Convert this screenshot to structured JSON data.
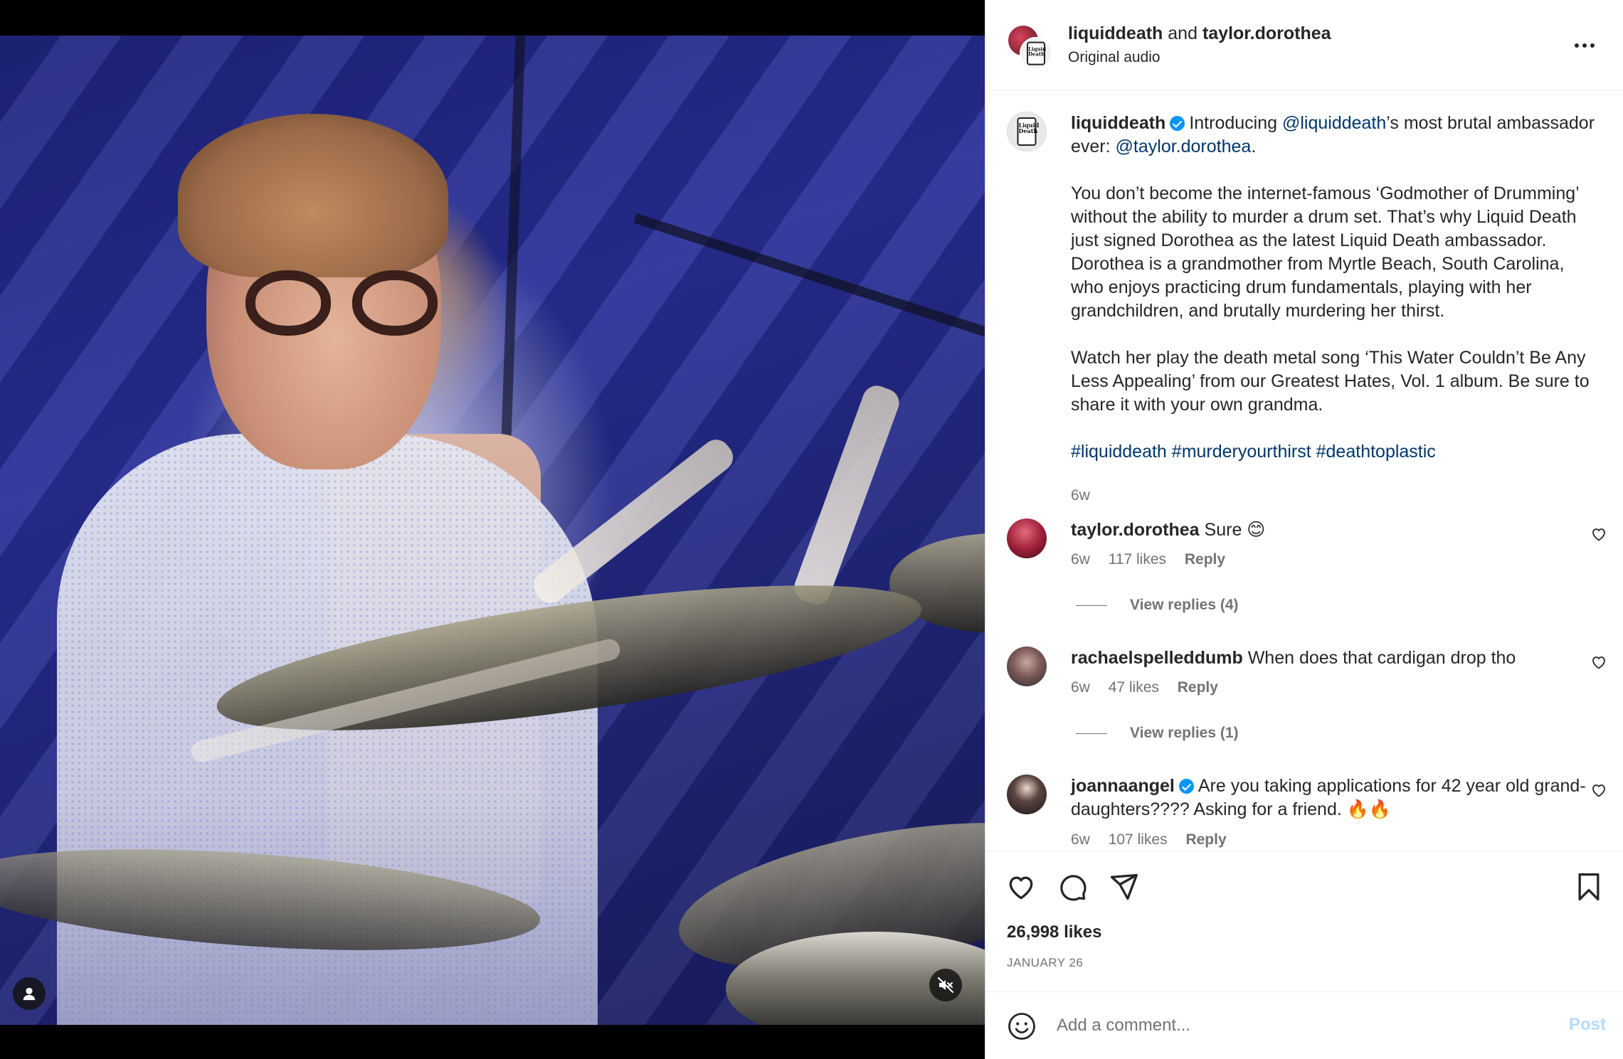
{
  "post": {
    "collaborators": [
      "liquiddeath",
      "taylor.dorothea"
    ],
    "and_text": "and",
    "audio": "Original audio",
    "caption": {
      "username": "liquiddeath",
      "line1_a": "Introducing ",
      "mention1": "@liquiddeath",
      "line1_b": "’s most brutal ambassador ever: ",
      "mention2": "@taylor.dorothea",
      "line1_c": ".",
      "para2": "You don’t become the internet-famous ‘Godmother of Drumming’ without the ability to murder a drum set. That’s why Liquid Death just signed Dorothea as the latest Liquid Death ambassador. Dorothea is a grandmother from Myrtle Beach, South Carolina, who enjoys practicing drum fundamentals, playing with her grandchildren, and brutally murdering her thirst.",
      "para3": "Watch her play the death metal song ‘This Water Couldn’t Be Any Less Appealing’ from our Greatest Hates, Vol. 1 album. Be sure to share it with your own grandma.",
      "hashtags": "#liquiddeath #murderyourthirst #deathtoplastic",
      "time": "6w"
    },
    "logo_text": "Liquid Death",
    "likes": "26,998 likes",
    "date": "JANUARY 26"
  },
  "comments": [
    {
      "username": "taylor.dorothea",
      "text": "Sure 😊",
      "time": "6w",
      "likes": "117 likes",
      "reply": "Reply",
      "view_replies": "View replies (4)"
    },
    {
      "username": "rachaelspelleddumb",
      "text": "When does that cardigan drop tho",
      "time": "6w",
      "likes": "47 likes",
      "reply": "Reply",
      "view_replies": "View replies (1)"
    },
    {
      "username": "joannaangel",
      "text": "Are you taking applications for 42 year old grand-daughters???? Asking for a friend. 🔥🔥",
      "time": "6w",
      "likes": "107 likes",
      "reply": "Reply"
    }
  ],
  "add_comment": {
    "placeholder": "Add a comment...",
    "post_label": "Post"
  },
  "icons": {
    "more": "more-options-icon",
    "like": "heart-icon",
    "comment": "comment-icon",
    "share": "share-icon",
    "save": "bookmark-icon",
    "emoji": "emoji-icon",
    "user": "user-tag-icon",
    "mute": "muted-icon"
  },
  "colors": {
    "link": "#00376b",
    "verified": "#0095f6",
    "post_disabled": "#b3dbff"
  }
}
